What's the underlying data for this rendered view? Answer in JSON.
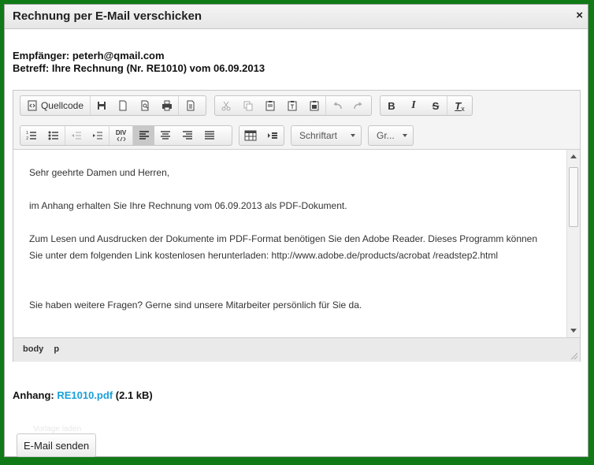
{
  "dialog": {
    "title": "Rechnung per E-Mail verschicken",
    "close_label": "×"
  },
  "meta": {
    "recipient": "Empfänger: peterh@qmail.com",
    "subject": "Betreff: Ihre Rechnung (Nr. RE1010) vom 06.09.2013"
  },
  "toolbar": {
    "source_label": "Quellcode",
    "font_combo": "Schriftart",
    "size_combo": "Gr...",
    "bold": "B",
    "italic": "I",
    "strike": "S",
    "removeformat": "T",
    "removeformat_sub": "x",
    "div": "DIV"
  },
  "content": {
    "paragraphs": [
      "Sehr geehrte Damen und Herren,",
      "im Anhang erhalten Sie Ihre Rechnung vom 06.09.2013 als PDF-Dokument.",
      "Zum Lesen und Ausdrucken der Dokumente im PDF-Format benötigen Sie den Adobe Reader. Dieses Programm können Sie unter dem folgenden Link kostenlosen herunterladen: http://www.adobe.de/products/acrobat /readstep2.html",
      "Sie haben weitere Fragen? Gerne sind unsere Mitarbeiter persönlich für Sie da."
    ]
  },
  "statusbar": {
    "path": [
      "body",
      "p"
    ]
  },
  "attachment": {
    "label": "Anhang:",
    "file": "RE1010.pdf",
    "size": "(2.1 kB)"
  },
  "faint_text": "Vorlage laden",
  "send_button": "E-Mail senden",
  "colors": {
    "frame": "#0f7a16",
    "link": "#1aa1d8"
  }
}
